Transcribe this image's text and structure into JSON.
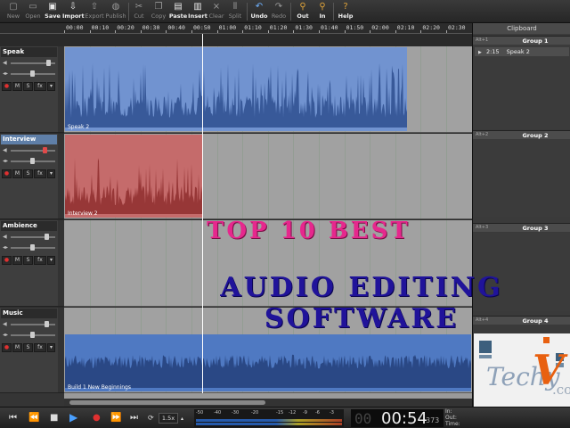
{
  "toolbar": {
    "items": [
      {
        "label": "New",
        "icon": "new-file-icon"
      },
      {
        "label": "Open",
        "icon": "folder-icon"
      },
      {
        "label": "Save",
        "icon": "save-icon"
      },
      {
        "label": "Import",
        "icon": "import-icon"
      },
      {
        "label": "Export",
        "icon": "export-icon"
      },
      {
        "label": "Publish",
        "icon": "globe-icon"
      },
      {
        "label": "Cut",
        "icon": "scissors-icon"
      },
      {
        "label": "Copy",
        "icon": "copy-icon"
      },
      {
        "label": "Paste",
        "icon": "paste-icon"
      },
      {
        "label": "Insert",
        "icon": "insert-icon"
      },
      {
        "label": "Clear",
        "icon": "clear-icon"
      },
      {
        "label": "Split",
        "icon": "split-icon"
      },
      {
        "label": "Undo",
        "icon": "undo-icon"
      },
      {
        "label": "Redo",
        "icon": "redo-icon"
      },
      {
        "label": "Out",
        "icon": "zoom-out-icon"
      },
      {
        "label": "In",
        "icon": "zoom-in-icon"
      },
      {
        "label": "Help",
        "icon": "help-icon"
      }
    ]
  },
  "ruler": {
    "ticks": [
      "00:00",
      "00:10",
      "00:20",
      "00:30",
      "00:40",
      "00:50",
      "01:00",
      "01:10",
      "01:20",
      "01:30",
      "01:40",
      "01:50",
      "02:00",
      "02:10",
      "02:20",
      "02:30"
    ]
  },
  "tracks": [
    {
      "name": "Speak",
      "clip_label": "Speak 2",
      "selected": false
    },
    {
      "name": "Interview",
      "clip_label": "Interview 2",
      "selected": true
    },
    {
      "name": "Ambience",
      "clip_label": "",
      "selected": false
    },
    {
      "name": "Music",
      "clip_label": "Build 1 New Beginnings",
      "selected": false
    }
  ],
  "track_buttons": {
    "record": "●",
    "mute": "M",
    "solo": "S",
    "fx": "fx",
    "menu": "▾"
  },
  "clipboard": {
    "title": "Clipboard",
    "groups": [
      {
        "alt": "Alt+1",
        "title": "Group 1"
      },
      {
        "alt": "Alt+2",
        "title": "Group 2"
      },
      {
        "alt": "Alt+3",
        "title": "Group 3"
      },
      {
        "alt": "Alt+4",
        "title": "Group 4"
      }
    ],
    "item": {
      "duration": "2:15",
      "name": "Speak 2"
    }
  },
  "overlay": {
    "line1": "TOP 10 BEST",
    "line2": "AUDIO EDITING SOFTWARE"
  },
  "logo": {
    "text": "Techy",
    "v": "V",
    "suffix": ".co"
  },
  "transport": {
    "speed": "1.5x",
    "meter_ticks": [
      "-50",
      "-40",
      "-30",
      "-20",
      "-15",
      "-12",
      "-9",
      "-6",
      "-3"
    ],
    "clock_dim": "00",
    "clock": "00:54",
    "clock_ms": "373",
    "in_label": "In:",
    "out_label": "Out:",
    "time_label": "Time:"
  },
  "colors": {
    "speak_clip": "#7193d0",
    "speak_wave": "#2e4f8f",
    "interview_clip": "#c56b6b",
    "interview_wave": "#8e2e2e",
    "music_clip": "#4f79c2",
    "music_wave": "#233f7a",
    "overlay_pink": "#e6288d",
    "overlay_blue": "#20139a"
  }
}
